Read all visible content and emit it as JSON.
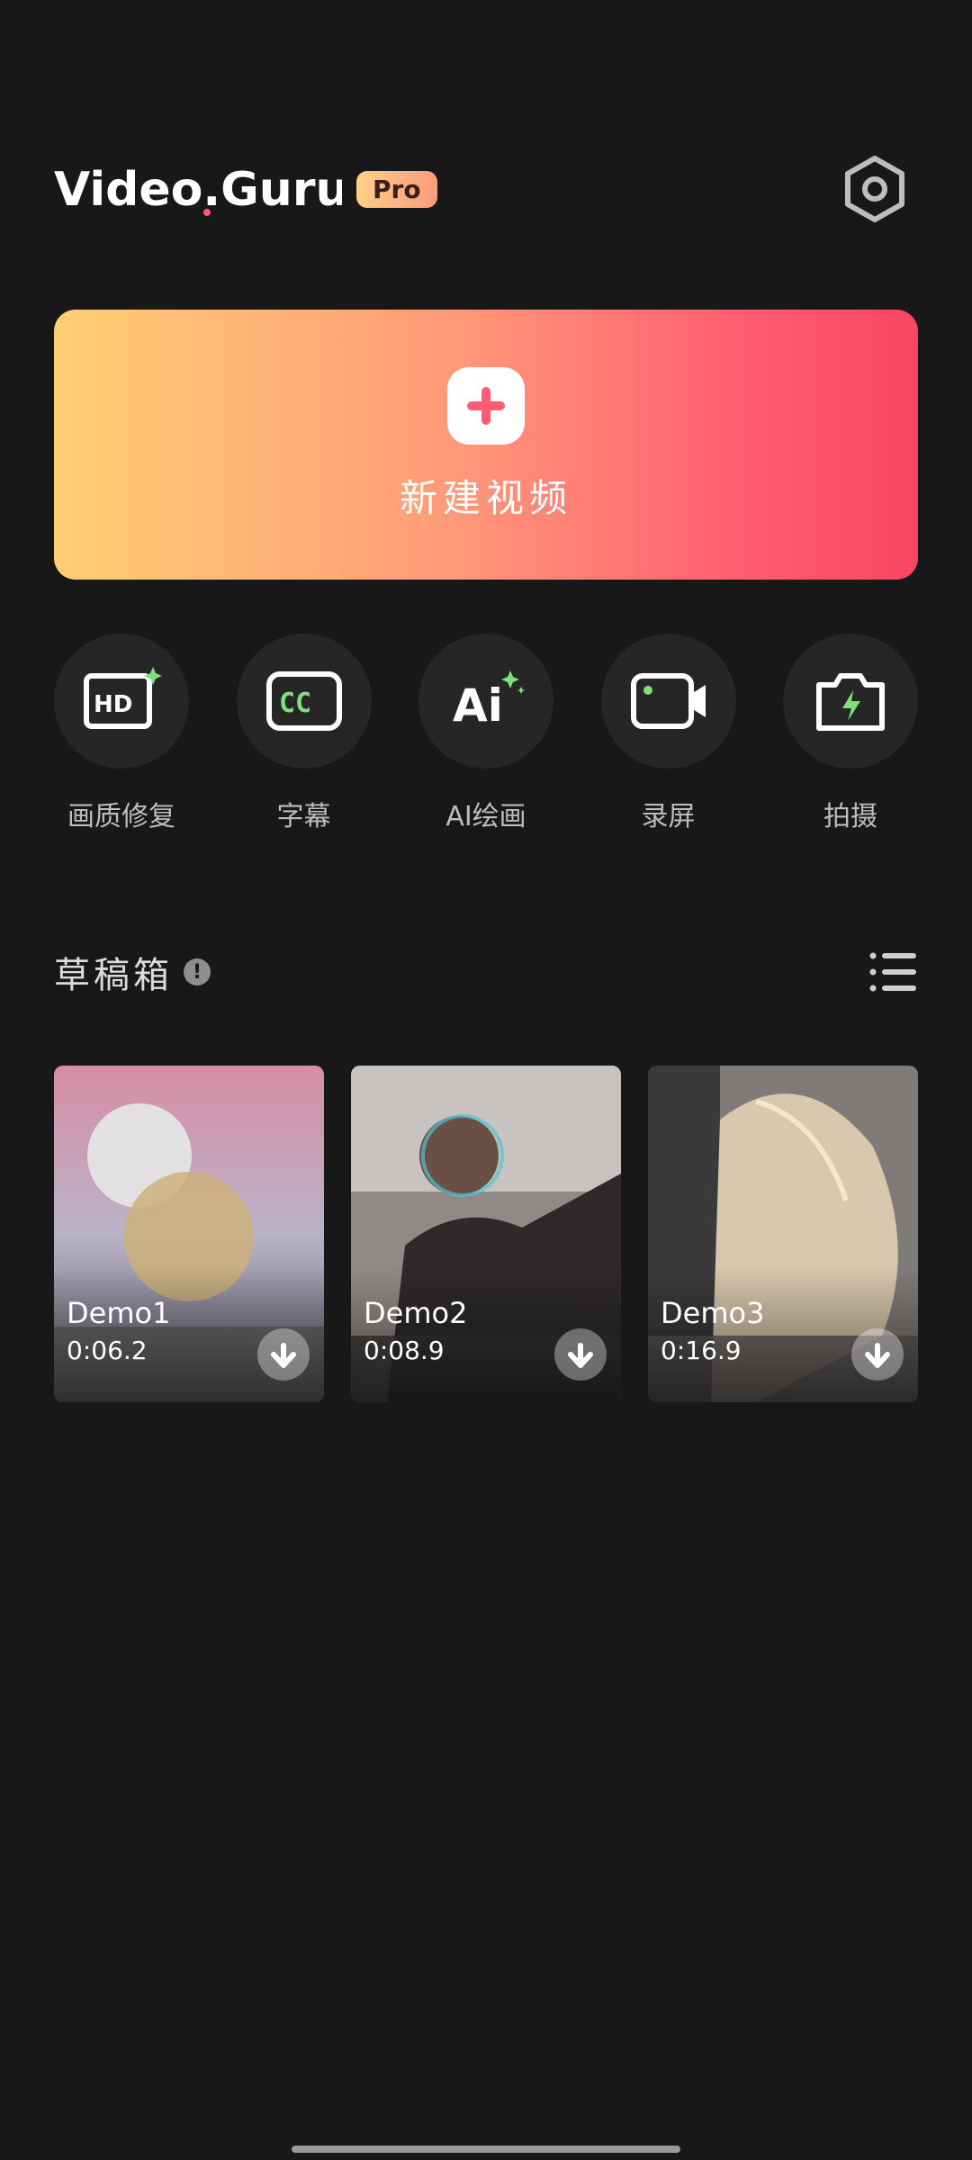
{
  "app": {
    "logo_text": "Video.Guru",
    "badge": "Pro"
  },
  "header": {
    "settings_icon": "gear-icon"
  },
  "new_video": {
    "label": "新建视频",
    "icon": "plus-icon"
  },
  "tools": [
    {
      "label": "画质修复",
      "icon": "hd-enhance-icon"
    },
    {
      "label": "字幕",
      "icon": "cc-subtitle-icon"
    },
    {
      "label": "AI绘画",
      "icon": "ai-paint-icon"
    },
    {
      "label": "录屏",
      "icon": "screen-record-icon"
    },
    {
      "label": "拍摄",
      "icon": "camera-icon"
    }
  ],
  "drafts": {
    "title": "草稿箱",
    "items": [
      {
        "name": "Demo1",
        "duration": "0:06.2"
      },
      {
        "name": "Demo2",
        "duration": "0:08.9"
      },
      {
        "name": "Demo3",
        "duration": "0:16.9"
      }
    ]
  },
  "colors": {
    "background": "#181818",
    "gradient_start": "#ffcf74",
    "gradient_end": "#f94563",
    "accent_pink": "#ff5c72",
    "cc_green": "#7ee07a"
  }
}
